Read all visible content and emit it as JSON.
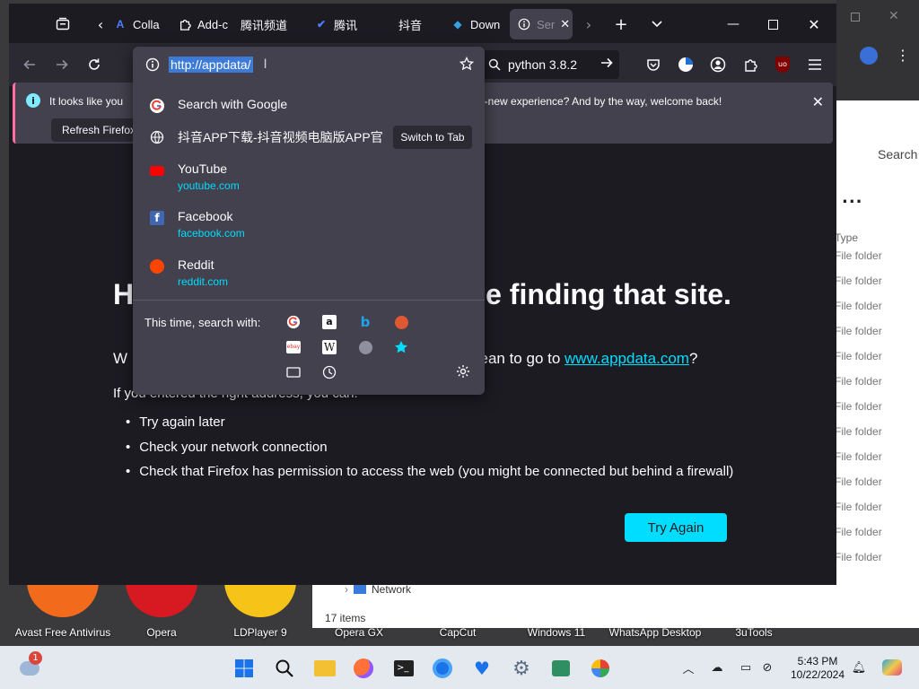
{
  "tabs": [
    {
      "label": "Colla",
      "fav": "blue-a"
    },
    {
      "label": "Add-c",
      "fav": "puzzle"
    },
    {
      "label": "腾讯频道",
      "fav": ""
    },
    {
      "label": "腾讯",
      "fav": "tencent"
    },
    {
      "label": "抖音",
      "fav": ""
    },
    {
      "label": "Down",
      "fav": "diamond"
    },
    {
      "label": "Ser",
      "fav": "info",
      "active": true
    }
  ],
  "navbar": {
    "url": "http://appdata/",
    "search_text": "python 3.8.2"
  },
  "notification": {
    "left_text": "It looks like you",
    "right_text": "e-new experience? And by the way, welcome back!",
    "refresh_label": "Refresh Firefox"
  },
  "url_dropdown": {
    "search_google": "Search with Google",
    "switch_title": "抖音APP下载-抖音视频电脑版APP官方",
    "switch_button": "Switch to Tab",
    "top_sites": [
      {
        "title": "YouTube",
        "url": "youtube.com"
      },
      {
        "title": "Facebook",
        "url": "facebook.com"
      },
      {
        "title": "Reddit",
        "url": "reddit.com"
      }
    ],
    "this_time": "This time, search with:"
  },
  "error_page": {
    "title_left": "H",
    "title_right": "e finding that site.",
    "dym_left": "W",
    "dym_right": "nean to go to ",
    "dym_link": "www.appdata.com",
    "dym_end": "?",
    "if_text": "If you entered the right address, you can:",
    "list": [
      "Try again later",
      "Check your network connection",
      "Check that Firefox has permission to access the web (you might be connected but behind a firewall)"
    ],
    "try_again": "Try Again"
  },
  "explorer": {
    "search": "Search",
    "more": "...",
    "type_header": "Type",
    "rows": [
      "File folder",
      "File folder",
      "File folder",
      "File folder",
      "File folder",
      "File folder",
      "File folder",
      "File folder",
      "File folder",
      "File folder",
      "File folder",
      "File folder",
      "File folder",
      "File folder"
    ],
    "network": "Network",
    "item_count": "17 items"
  },
  "desktop_icons": [
    "Avast Free Antivirus",
    "Opera",
    "LDPlayer 9",
    "Opera GX",
    "CapCut",
    "Windows 11",
    "WhatsApp Desktop",
    "3uTools"
  ],
  "taskbar": {
    "time": "5:43 PM",
    "date": "10/22/2024",
    "weather_badge": "1"
  }
}
